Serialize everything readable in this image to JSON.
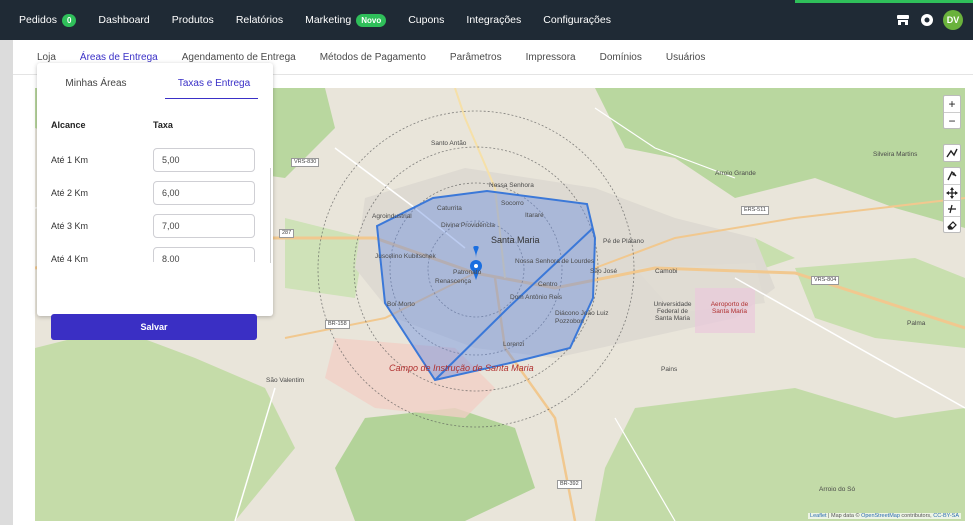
{
  "topnav": {
    "items": [
      {
        "label": "Pedidos",
        "badge": "0"
      },
      {
        "label": "Dashboard"
      },
      {
        "label": "Produtos"
      },
      {
        "label": "Relatórios"
      },
      {
        "label": "Marketing",
        "badge": "Novo"
      },
      {
        "label": "Cupons"
      },
      {
        "label": "Integrações"
      },
      {
        "label": "Configurações"
      }
    ],
    "right_icons": [
      "store-icon",
      "settings-icon"
    ],
    "avatar_initials": "DV",
    "colors": {
      "bar": "#1f2a35",
      "badge": "#2fbf5a",
      "accent": "#2fbf5a"
    }
  },
  "tabs": {
    "items": [
      "Loja",
      "Áreas de Entrega",
      "Agendamento de Entrega",
      "Métodos de Pagamento",
      "Parâmetros",
      "Impressora",
      "Domínios",
      "Usuários"
    ],
    "active": "Áreas de Entrega"
  },
  "delivery_card": {
    "tabs": [
      "Minhas Áreas",
      "Taxas e Entrega"
    ],
    "active_tab": "Taxas e Entrega",
    "col_range": "Alcance",
    "col_fee": "Taxa",
    "rows": [
      {
        "range": "Até 1 Km",
        "fee": "5,00"
      },
      {
        "range": "Até 2 Km",
        "fee": "6,00"
      },
      {
        "range": "Até 3 Km",
        "fee": "7,00"
      },
      {
        "range": "Até 4 Km",
        "fee": "8,00"
      }
    ],
    "save_label": "Salvar",
    "button_color": "#3a2fc4"
  },
  "map": {
    "zoom_in": "+",
    "zoom_out": "−",
    "draw_tools_top": [
      "draw-polyline-icon"
    ],
    "draw_tools": [
      "draw-polygon-icon",
      "move-icon",
      "cut-icon",
      "eraser-icon"
    ],
    "labels": {
      "santo_antao": "Santo Antão",
      "nossa_senhora": "Nossa Senhora",
      "camobi": "Camobi",
      "arroio_grande": "Arroio Grande",
      "silveira_martins": "Silveira Martins",
      "santa_maria": "Santa Maria",
      "divina_providencia": "Divina Providência",
      "juscelino": "Juscelino Kubitschek",
      "pe_de_platano": "Pé de Plátano",
      "sao_jose": "São José",
      "renascenca": "Renascença",
      "boi_morto": "Boi Morto",
      "lorenzi": "Lorenzi",
      "pains": "Pains",
      "sao_valentim": "São Valentim",
      "palma": "Palma",
      "arroio_do_so": "Arroio do Só",
      "camobi_univ": "Universidade Federal de Santa Maria",
      "aeroporto": "Aeroporto de Santa Maria",
      "campo_instrucao": "Campo de Instrução de Santa Maria",
      "caturrita": "Caturrita",
      "socorro": "Socorro",
      "itarare": "Itararé",
      "nossa_senhora_lourdes": "Nossa Senhora de Lourdes",
      "centro": "Centro",
      "dom_antonio_reis": "Dom Antônio Reis",
      "diacono_joao": "Diácono João Luiz Pozzobon",
      "agroindustrial": "Agroindustrial",
      "patronato": "Patronato"
    },
    "roads": {
      "vrs830": "VRS-830",
      "ers511": "ERS-511",
      "vrs804": "VRS-804",
      "br158": "BR-158",
      "br392": "BR-392",
      "br287": "287"
    },
    "attribution": {
      "leaflet": "Leaflet",
      "mid": " | Map data © ",
      "osm": "OpenStreetMap",
      "contrib": " contributors, ",
      "license": "CC-BY-SA"
    },
    "area_fill": "#6a8fe0",
    "area_stroke": "#3b78d8"
  }
}
